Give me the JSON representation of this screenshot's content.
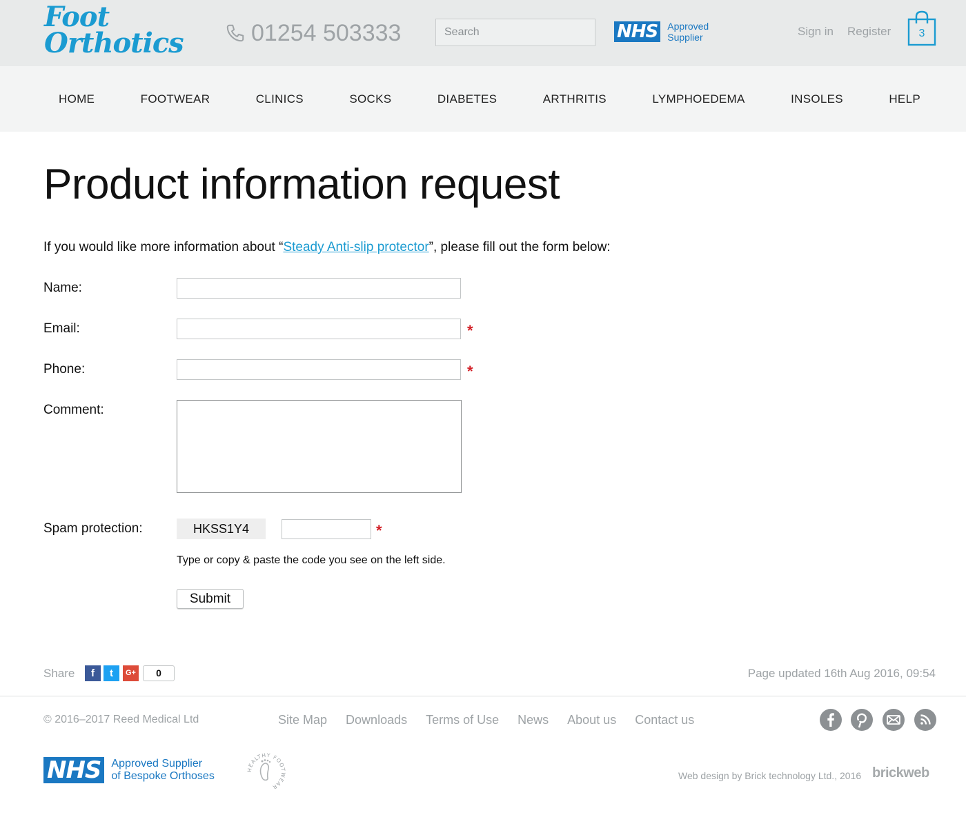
{
  "header": {
    "logo_line1": "Foot",
    "logo_line2": "Orthotics",
    "phone": "01254 503333",
    "search_placeholder": "Search",
    "nhs_logo": "NHS",
    "nhs_line1": "Approved",
    "nhs_line2": "Supplier",
    "sign_in": "Sign in",
    "register": "Register",
    "cart_count": "3"
  },
  "nav": {
    "items": [
      "HOME",
      "FOOTWEAR",
      "CLINICS",
      "SOCKS",
      "DIABETES",
      "ARTHRITIS",
      "LYMPHOEDEMA",
      "INSOLES",
      "HELP"
    ]
  },
  "main": {
    "title": "Product information request",
    "intro_before": "If you would like more information about “",
    "intro_link": "Steady Anti-slip protector",
    "intro_after": "”, please fill out the form below:",
    "form": {
      "name_label": "Name:",
      "name_value": "",
      "email_label": "Email:",
      "email_value": "",
      "phone_label": "Phone:",
      "phone_value": "",
      "comment_label": "Comment:",
      "comment_value": "",
      "spam_label": "Spam protection:",
      "captcha_code": "HKSS1Y4",
      "captcha_value": "",
      "required_mark": "*",
      "hint": "Type or copy & paste the code you see on the left side.",
      "submit_label": "Submit"
    }
  },
  "share": {
    "label": "Share",
    "facebook": "f",
    "twitter": "t",
    "googleplus": "G+",
    "count": "0",
    "updated": "Page updated 16th Aug 2016, 09:54"
  },
  "footer": {
    "copyright": "© 2016–2017  Reed Medical Ltd",
    "links": [
      "Site Map",
      "Downloads",
      "Terms of Use",
      "News",
      "About us",
      "Contact us"
    ],
    "social_icons": [
      "facebook-icon",
      "pinterest-icon",
      "email-icon",
      "rss-icon"
    ],
    "nhs_logo": "NHS",
    "nhs_line1": "Approved Supplier",
    "nhs_line2": "of Bespoke Orthoses",
    "hfg_logo_text": "HEALTHY FOOTWEAR GUIDE",
    "web_design": "Web design by Brick technology Ltd., 2016",
    "brickweb": "brickweb"
  },
  "colors": {
    "brand_blue": "#1b9bd1",
    "nhs_blue": "#1a78c2",
    "required_red": "#d21f26",
    "muted_grey": "#9ea3a6",
    "header_bg": "#e8eaea",
    "nav_bg": "#f3f4f4"
  }
}
